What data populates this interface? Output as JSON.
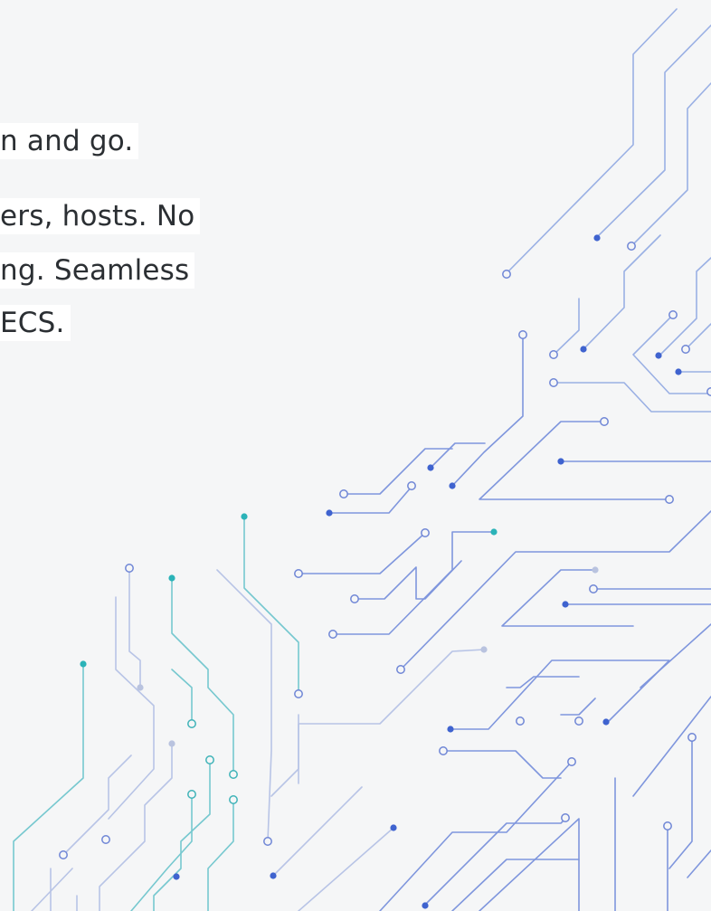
{
  "slide": {
    "lines": [
      "n and go.",
      "ers, hosts. No",
      "ng. Seamless",
      "ECS."
    ]
  },
  "colors": {
    "background": "#f5f6f7",
    "text_highlight": "#ffffff",
    "text": "#2b2f33",
    "circuit_blue": "#3f63cf",
    "circuit_teal": "#2bb3b8",
    "circuit_light": "#b7c2e6",
    "circuit_light_teal": "#9bd8dc"
  },
  "decoration": {
    "icon": "circuit-board-pattern-icon"
  }
}
